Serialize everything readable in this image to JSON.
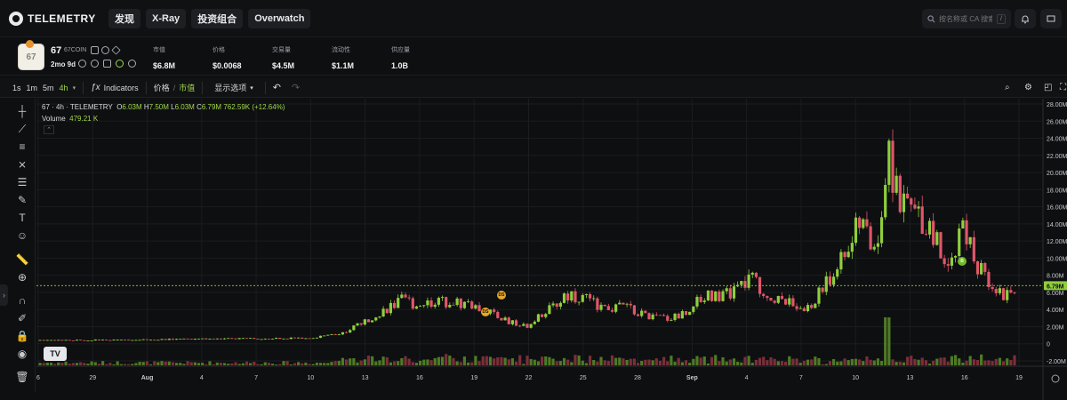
{
  "nav": {
    "logo": "TELEMETRY",
    "items": [
      "发现",
      "X-Ray",
      "投资组合",
      "Overwatch"
    ],
    "search_placeholder": "按名称或 CA 搜索...",
    "search_shortcut": "/"
  },
  "token": {
    "name": "67",
    "symbol": "67COIN",
    "age": "2mo 9d",
    "avatar_text": "67",
    "stats": [
      {
        "label": "市值",
        "value": "$6.8M"
      },
      {
        "label": "价格",
        "value": "$0.0068"
      },
      {
        "label": "交易量",
        "value": "$4.5M"
      },
      {
        "label": "流动性",
        "value": "$1.1M"
      },
      {
        "label": "供应量",
        "value": "1.0B"
      }
    ]
  },
  "toolbar": {
    "timeframes": [
      "1s",
      "1m",
      "5m",
      "4h"
    ],
    "active_timeframe": "4h",
    "indicators": "Indicators",
    "price_label": "价格",
    "mcap_label": "市值",
    "display_options": "显示选项"
  },
  "legend": {
    "title": "67 · 4h · TELEMETRY",
    "o_label": "O",
    "o": "6.03M",
    "h_label": "H",
    "h": "7.50M",
    "l_label": "L",
    "l": "6.03M",
    "c_label": "C",
    "c": "6.79M",
    "change": "762.59K (+12.64%)",
    "volume_label": "Volume",
    "volume": "479.21 K"
  },
  "colors": {
    "up": "#8fcf3c",
    "down": "#e0566a",
    "accent": "#9fd846",
    "grid": "#1a1c20"
  },
  "markers": [
    {
      "label": "DS",
      "date": "Aug 20"
    },
    {
      "label": "DS",
      "date": "Aug 21"
    },
    {
      "label": "B",
      "date": "Sep 15"
    }
  ],
  "chart_data": {
    "type": "candlestick",
    "y_unit": "market cap",
    "ylim": [
      -2000000,
      28000000
    ],
    "y_ticks": [
      "28.00M",
      "26.00M",
      "24.00M",
      "22.00M",
      "20.00M",
      "18.00M",
      "16.00M",
      "14.00M",
      "12.00M",
      "10.00M",
      "8.00M",
      "6.00M",
      "4.00M",
      "2.00M",
      "0",
      "-2.00M"
    ],
    "y_tick_values": [
      28000000,
      26000000,
      24000000,
      22000000,
      20000000,
      18000000,
      16000000,
      14000000,
      12000000,
      10000000,
      8000000,
      6000000,
      4000000,
      2000000,
      0,
      -2000000
    ],
    "x_ticks": [
      "6",
      "29",
      "Aug",
      "4",
      "7",
      "10",
      "13",
      "16",
      "19",
      "22",
      "25",
      "28",
      "Sep",
      "4",
      "7",
      "10",
      "13",
      "16",
      "19"
    ],
    "current_value_label": "6.79M",
    "current_value": 6790000,
    "series_close": [
      [
        0,
        0.4
      ],
      [
        0.08,
        0.45
      ],
      [
        0.16,
        0.55
      ],
      [
        0.26,
        0.65
      ],
      [
        0.28,
        0.7
      ],
      [
        0.31,
        1.2
      ],
      [
        0.33,
        2.5
      ],
      [
        0.35,
        3.5
      ],
      [
        0.37,
        5.2
      ],
      [
        0.38,
        4.7
      ],
      [
        0.42,
        4.9
      ],
      [
        0.44,
        4.5
      ],
      [
        0.46,
        3.7
      ],
      [
        0.48,
        2.6
      ],
      [
        0.5,
        2.1
      ],
      [
        0.52,
        3.9
      ],
      [
        0.54,
        5.6
      ],
      [
        0.56,
        5.2
      ],
      [
        0.58,
        4.1
      ],
      [
        0.6,
        4.3
      ],
      [
        0.62,
        3.4
      ],
      [
        0.64,
        2.9
      ],
      [
        0.66,
        3.5
      ],
      [
        0.68,
        5.8
      ],
      [
        0.7,
        5.5
      ],
      [
        0.72,
        6.6
      ],
      [
        0.73,
        7.6
      ],
      [
        0.75,
        5.3
      ],
      [
        0.77,
        4.7
      ],
      [
        0.79,
        4.2
      ],
      [
        0.8,
        6.1
      ],
      [
        0.82,
        9.5
      ],
      [
        0.84,
        14.6
      ],
      [
        0.85,
        11.8
      ],
      [
        0.86,
        13.0
      ],
      [
        0.87,
        23.0
      ],
      [
        0.88,
        17.5
      ],
      [
        0.9,
        14.5
      ],
      [
        0.92,
        12.5
      ],
      [
        0.93,
        10.0
      ],
      [
        0.95,
        13.5
      ],
      [
        0.96,
        9.5
      ],
      [
        0.97,
        7.8
      ],
      [
        0.98,
        6.5
      ],
      [
        0.99,
        5.5
      ],
      [
        1.0,
        6.79
      ]
    ]
  }
}
